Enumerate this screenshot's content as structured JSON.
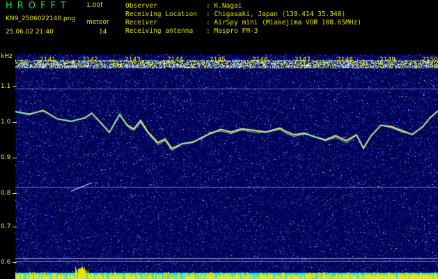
{
  "header": {
    "title": "HROFFT",
    "version": "1.00f",
    "filename": "KN9_2506022140.png",
    "meteor_label": "meteor",
    "meteor_count": "14",
    "datetime": "25.06.02 21:40",
    "info": [
      {
        "label": "Observer",
        "sep": ":",
        "value": "K.Nagai"
      },
      {
        "label": "Receiving Location",
        "sep": ":",
        "value": "Chigasaki, Japan (139.414 35.340)"
      },
      {
        "label": "Receiver",
        "sep": ":",
        "value": "AirSpy mini (Miakejima VOR 108.65MHz)"
      },
      {
        "label": "Receiving antenna",
        "sep": ":",
        "value": "Maspro FM-3"
      }
    ]
  },
  "plot": {
    "unit_label": "kHz",
    "y_ticks": [
      "1.1",
      "1.0",
      "0.9",
      "0.8",
      "0.7",
      "0.6"
    ],
    "x_ticks": [
      "2141",
      "2142",
      "2143",
      "2144",
      "2145",
      "2146",
      "2147",
      "2148",
      "2149",
      "2150"
    ],
    "colors": {
      "background": "#020258",
      "noise": "#3a7bff",
      "trace": "#ffffff",
      "carrier_band": "#e6e600",
      "bottom_cyan": "#00e6ff"
    }
  }
}
